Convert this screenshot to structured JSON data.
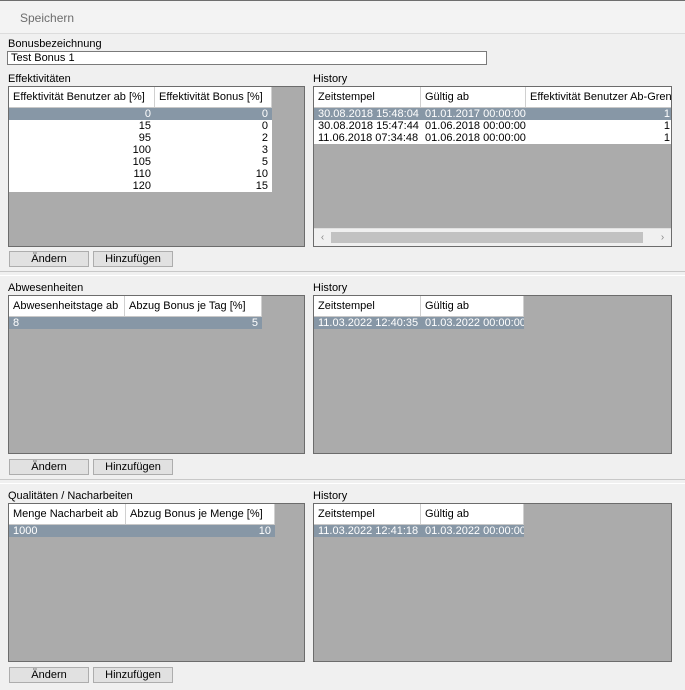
{
  "toolbar": {
    "save_label": "Speichern"
  },
  "bonus": {
    "label": "Bonusbezeichnung",
    "value": "Test Bonus 1"
  },
  "effektivitaeten": {
    "title": "Effektivitäten",
    "columns": [
      "Effektivität Benutzer ab [%]",
      "Effektivität Bonus [%]"
    ],
    "rows": [
      [
        "0",
        "0"
      ],
      [
        "15",
        "0"
      ],
      [
        "95",
        "2"
      ],
      [
        "100",
        "3"
      ],
      [
        "105",
        "5"
      ],
      [
        "110",
        "10"
      ],
      [
        "120",
        "15"
      ]
    ],
    "buttons": {
      "change": "Ändern",
      "add": "Hinzufügen"
    }
  },
  "effektivitaeten_history": {
    "title": "History",
    "columns": [
      "Zeitstempel",
      "Gültig ab",
      "Effektivität Benutzer Ab-Grenze"
    ],
    "rows": [
      [
        "30.08.2018 15:48:04",
        "01.01.2017 00:00:00",
        "1"
      ],
      [
        "30.08.2018 15:47:44",
        "01.06.2018 00:00:00",
        "1"
      ],
      [
        "11.06.2018 07:34:48",
        "01.06.2018 00:00:00",
        "1"
      ]
    ]
  },
  "abwesenheiten": {
    "title": "Abwesenheiten",
    "columns": [
      "Abwesenheitstage ab",
      "Abzug Bonus je Tag [%]"
    ],
    "rows": [
      [
        "8",
        "5"
      ]
    ],
    "buttons": {
      "change": "Ändern",
      "add": "Hinzufügen"
    }
  },
  "abwesenheiten_history": {
    "title": "History",
    "columns": [
      "Zeitstempel",
      "Gültig ab"
    ],
    "rows": [
      [
        "11.03.2022 12:40:35",
        "01.03.2022 00:00:00"
      ]
    ]
  },
  "qualitaeten": {
    "title": "Qualitäten / Nacharbeiten",
    "columns": [
      "Menge Nacharbeit ab",
      "Abzug Bonus je Menge [%]"
    ],
    "rows": [
      [
        "1000",
        "10"
      ]
    ],
    "buttons": {
      "change": "Ändern",
      "add": "Hinzufügen"
    }
  },
  "qualitaeten_history": {
    "title": "History",
    "columns": [
      "Zeitstempel",
      "Gültig ab"
    ],
    "rows": [
      [
        "11.03.2022 12:41:18",
        "01.03.2022 00:00:00"
      ]
    ]
  },
  "icons": {
    "scroll_left": "chevron-left-icon",
    "scroll_right": "chevron-right-icon"
  }
}
